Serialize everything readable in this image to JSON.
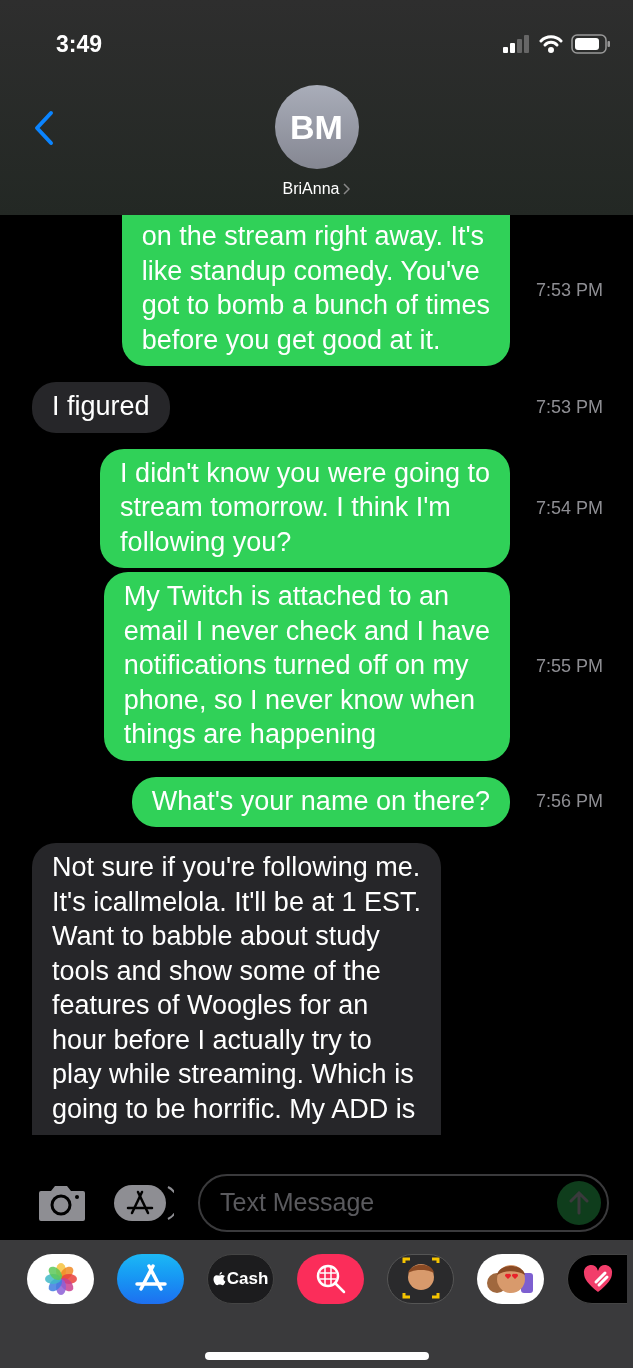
{
  "status_bar": {
    "time": "3:49"
  },
  "header": {
    "initials": "BM",
    "name": "BriAnna"
  },
  "messages": [
    {
      "kind": "sent",
      "cut_top": true,
      "cut_bottom": false,
      "lines": [
        "on the stream right away. It's",
        "like standup comedy. You've",
        "got to bomb a bunch of times",
        "before you get good at it."
      ],
      "time": "7:53 PM"
    },
    {
      "kind": "received",
      "cut_top": false,
      "cut_bottom": false,
      "lines": [
        "I figured"
      ],
      "time": "7:53 PM"
    },
    {
      "kind": "sent",
      "cut_top": false,
      "cut_bottom": false,
      "lines": [
        "I didn't know you were going to",
        "stream tomorrow. I think I'm",
        "following you?"
      ],
      "time": "7:54 PM"
    },
    {
      "kind": "sent",
      "cut_top": false,
      "cut_bottom": false,
      "lines": [
        "My Twitch is attached to an",
        "email I never check and I have",
        "notifications turned off on my",
        "phone, so I never know when",
        "things are happening"
      ],
      "time": "7:55 PM"
    },
    {
      "kind": "sent",
      "cut_top": false,
      "cut_bottom": false,
      "lines": [
        "What's your name on there?"
      ],
      "time": "7:56 PM"
    },
    {
      "kind": "received",
      "cut_top": false,
      "cut_bottom": true,
      "lines": [
        "Not sure if you're following me.",
        "It's icallmelola. It'll be at 1 EST.",
        "Want to babble about study",
        "tools and show some of the",
        "features of Woogles for an",
        "hour before I actually try to",
        "play while streaming. Which is",
        "going to be horrific. My ADD is"
      ]
    }
  ],
  "composer": {
    "placeholder": "Text Message"
  },
  "app_drawer": [
    {
      "kind": "photos"
    },
    {
      "kind": "app_store"
    },
    {
      "kind": "cash",
      "label": "Cash"
    },
    {
      "kind": "search"
    },
    {
      "kind": "memoji"
    },
    {
      "kind": "stickers"
    },
    {
      "kind": "touch"
    }
  ]
}
